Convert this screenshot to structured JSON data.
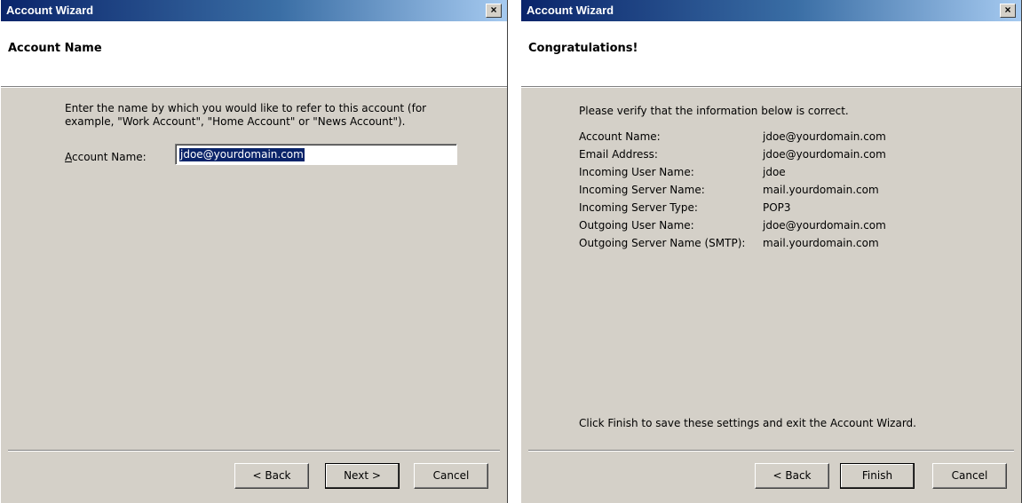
{
  "left_window": {
    "title": "Account Wizard",
    "close_glyph": "×",
    "header": "Account Name",
    "description": "Enter the name by which you would like to refer to this account (for example, \"Work Account\", \"Home Account\" or \"News Account\").",
    "field_label_accesskey": "A",
    "field_label_rest": "ccount Name:",
    "field_value": "jdoe@yourdomain.com",
    "buttons": {
      "back": "< Back",
      "next": "Next >",
      "cancel": "Cancel"
    }
  },
  "right_window": {
    "title": "Account Wizard",
    "close_glyph": "×",
    "header": "Congratulations!",
    "intro": "Please verify that the information below is correct.",
    "rows": [
      {
        "label": "Account Name:",
        "value": "jdoe@yourdomain.com"
      },
      {
        "label": "Email Address:",
        "value": "jdoe@yourdomain.com"
      },
      {
        "label": "Incoming User Name:",
        "value": "jdoe"
      },
      {
        "label": "Incoming Server Name:",
        "value": "mail.yourdomain.com"
      },
      {
        "label": "Incoming Server Type:",
        "value": "POP3"
      },
      {
        "label": "Outgoing User Name:",
        "value": "jdoe@yourdomain.com"
      },
      {
        "label": "Outgoing Server Name (SMTP):",
        "value": "mail.yourdomain.com"
      }
    ],
    "footer_note": "Click Finish to save these settings and exit the Account Wizard.",
    "buttons": {
      "back": "< Back",
      "finish": "Finish",
      "cancel": "Cancel"
    }
  },
  "colors": {
    "titlebar_start": "#0a246a",
    "titlebar_end": "#a6caf0",
    "dialog_face": "#d4d0c8",
    "selection": "#0a246a"
  }
}
